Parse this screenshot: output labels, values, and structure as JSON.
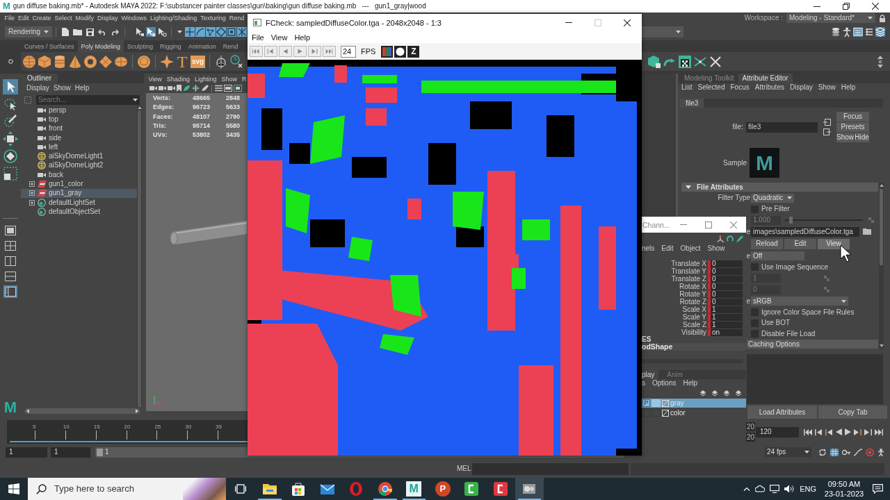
{
  "title_bar": {
    "logo": "M",
    "title": "gun diffuse baking.mb* - Autodesk MAYA 2022: F:\\substancer painter classes\\gun\\baking\\gun diffuse baking.mb   ---   gun1_gray|wood"
  },
  "menu_bar": [
    "File",
    "Edit",
    "Create",
    "Select",
    "Modify",
    "Display",
    "Windows",
    "Lighting/Shading",
    "Texturing",
    "Rend"
  ],
  "workspace": {
    "label": "Workspace :",
    "value": "Modeling - Standard*"
  },
  "status_line": {
    "menu_set": "Rendering",
    "select_modes": [
      {
        "kind": "hierarchy",
        "on": false
      },
      {
        "kind": "object",
        "on": true
      },
      {
        "kind": "component",
        "on": false
      }
    ],
    "masks": [
      {
        "kind": "cross",
        "on": true
      },
      {
        "kind": "curve",
        "on": true
      },
      {
        "kind": "points",
        "on": true
      },
      {
        "kind": "diamond",
        "on": true
      },
      {
        "kind": "frame",
        "on": true
      },
      {
        "kind": "burst",
        "on": true
      }
    ],
    "panel_toggles": [
      {
        "kind": "stack",
        "on": false
      },
      {
        "kind": "figure",
        "on": false
      },
      {
        "kind": "panel",
        "on": true
      },
      {
        "kind": "list",
        "on": false
      },
      {
        "kind": "layers",
        "on": true
      }
    ]
  },
  "shelf": {
    "tabs": [
      {
        "label": "Curves / Surfaces",
        "selected": false
      },
      {
        "label": "Poly Modeling",
        "selected": true
      },
      {
        "label": "Sculpting",
        "selected": false
      },
      {
        "label": "Rigging",
        "selected": false
      },
      {
        "label": "Animation",
        "selected": false
      },
      {
        "label": "Rend",
        "selected": false
      }
    ],
    "items": [
      {
        "kind": "sphere"
      },
      {
        "kind": "cube"
      },
      {
        "kind": "cylinder"
      },
      {
        "kind": "cone"
      },
      {
        "kind": "torus"
      },
      {
        "kind": "plane"
      },
      {
        "kind": "disc"
      },
      {
        "kind": "divider"
      },
      {
        "kind": "platonic"
      },
      {
        "kind": "divider"
      },
      {
        "kind": "star"
      },
      {
        "kind": "glyph",
        "text": "T"
      },
      {
        "kind": "badge",
        "text": "svg"
      },
      {
        "kind": "divider"
      },
      {
        "kind": "pivot"
      },
      {
        "kind": "clock"
      }
    ]
  },
  "toolbox": {
    "tools": [
      {
        "kind": "select",
        "selected": true
      },
      {
        "kind": "lasso",
        "selected": false
      },
      {
        "kind": "paint",
        "selected": false
      },
      {
        "kind": "move",
        "selected": false
      },
      {
        "kind": "rotate",
        "selected": false
      },
      {
        "kind": "scale",
        "selected": false
      }
    ],
    "layouts": [
      {
        "kind": "single",
        "selected": false
      },
      {
        "kind": "quad",
        "selected": false
      },
      {
        "kind": "side",
        "selected": false
      },
      {
        "kind": "stacked",
        "selected": false
      },
      {
        "kind": "outliner",
        "selected": true
      }
    ],
    "logo": "M"
  },
  "outliner": {
    "tab": "Outliner",
    "menu": [
      "Display",
      "Show",
      "Help"
    ],
    "search_placeholder": "Search...",
    "items": [
      {
        "label": "persp",
        "kind": "camera",
        "expander": false,
        "selected": false
      },
      {
        "label": "top",
        "kind": "camera",
        "expander": false,
        "selected": false
      },
      {
        "label": "front",
        "kind": "camera",
        "expander": false,
        "selected": false
      },
      {
        "label": "side",
        "kind": "camera",
        "expander": false,
        "selected": false
      },
      {
        "label": "left",
        "kind": "camera",
        "expander": false,
        "selected": false
      },
      {
        "label": "aiSkyDomeLight1",
        "kind": "light",
        "expander": false,
        "selected": false
      },
      {
        "label": "aiSkyDomeLight2",
        "kind": "light",
        "expander": false,
        "selected": false
      },
      {
        "label": "back",
        "kind": "camera",
        "expander": false,
        "selected": false
      },
      {
        "label": "gun1_color",
        "kind": "layer",
        "expander": true,
        "selected": false
      },
      {
        "label": "gun1_gray",
        "kind": "layer",
        "expander": true,
        "selected": true
      },
      {
        "label": "defaultLightSet",
        "kind": "set",
        "expander": true,
        "selected": false
      },
      {
        "label": "defaultObjectSet",
        "kind": "set",
        "expander": false,
        "selected": false
      }
    ]
  },
  "viewport": {
    "menu": [
      "View",
      "Shading",
      "Lighting",
      "Show",
      "R"
    ],
    "hud": [
      {
        "label": "Verts:",
        "total": "48665",
        "selection": "2848"
      },
      {
        "label": "Edges:",
        "total": "96723",
        "selection": "5633"
      },
      {
        "label": "Faces:",
        "total": "48107",
        "selection": "2790"
      },
      {
        "label": "Tris:",
        "total": "95714",
        "selection": "5580"
      },
      {
        "label": "UVs:",
        "total": "53802",
        "selection": "3435"
      }
    ]
  },
  "attribute_editor": {
    "tabs": [
      {
        "label": "Modeling Toolkit",
        "selected": false
      },
      {
        "label": "Attribute Editor",
        "selected": true
      }
    ],
    "menu": [
      "List",
      "Selected",
      "Focus",
      "Attributes",
      "Display",
      "Show",
      "Help"
    ],
    "node_tab": "file3",
    "node_label": "file:",
    "node_name": "file3",
    "side_buttons": [
      "Focus",
      "Presets",
      "Show",
      "Hide"
    ],
    "sample_label": "Sample",
    "sample_swatch": "M",
    "section": {
      "title": "File Attributes",
      "expanded": true,
      "rows": [
        {
          "kind": "dropdown",
          "label": "Filter Type",
          "value": "Quadratic"
        },
        {
          "kind": "checkbox",
          "label": "Pre Filter",
          "checked": false
        },
        {
          "kind": "slider",
          "value": "1.000",
          "disabled": true,
          "level": 0.07
        },
        {
          "kind": "file",
          "label": "e",
          "value": "images\\sampledDiffuseColor.tga"
        },
        {
          "kind": "buttons",
          "buttons": [
            {
              "label": "Reload",
              "hovered": false
            },
            {
              "label": "Edit",
              "hovered": false
            },
            {
              "label": "View",
              "hovered": true
            }
          ]
        },
        {
          "kind": "field",
          "label": "e",
          "value": "Off"
        },
        {
          "kind": "checkbox",
          "label": "Use Image Sequence",
          "checked": false
        },
        {
          "kind": "number",
          "value": "1",
          "disabled": true
        },
        {
          "kind": "number",
          "value": "0",
          "disabled": true
        },
        {
          "kind": "dropdown",
          "label": "e",
          "value": "sRGB"
        },
        {
          "kind": "checkbox",
          "label": "Ignore Color Space File Rules",
          "checked": false
        },
        {
          "kind": "checkbox",
          "label": "Use BOT",
          "checked": false
        },
        {
          "kind": "checkbox",
          "label": "Disable File Load",
          "checked": false
        }
      ]
    },
    "next_section": "Caching Options",
    "bottom_buttons": [
      "Load Attributes",
      "Copy Tab"
    ]
  },
  "channel_box": {
    "title": "Chann...",
    "menu": [
      "nels",
      "Edit",
      "Object",
      "Show"
    ],
    "channels": [
      {
        "label": "Translate X",
        "value": "0",
        "keyed": true
      },
      {
        "label": "Translate Y",
        "value": "0",
        "keyed": true
      },
      {
        "label": "Translate Z",
        "value": "0",
        "keyed": true
      },
      {
        "label": "Rotate X",
        "value": "0",
        "keyed": true
      },
      {
        "label": "Rotate Y",
        "value": "0",
        "keyed": true
      },
      {
        "label": "Rotate Z",
        "value": "0",
        "keyed": true
      },
      {
        "label": "Scale X",
        "value": "1",
        "keyed": true
      },
      {
        "label": "Scale Y",
        "value": "1",
        "keyed": true
      },
      {
        "label": "Scale Z",
        "value": "1",
        "keyed": true
      },
      {
        "label": "Visibility",
        "value": "on",
        "keyed": true
      }
    ],
    "shapes_heading": "ES",
    "shape_name": "odShape",
    "layer_editor": {
      "tabs": [
        {
          "label": "play",
          "selected": true
        },
        {
          "label": "Anim",
          "selected": false
        }
      ],
      "menu": [
        "s",
        "Options",
        "Help"
      ],
      "layers": [
        {
          "name": "gray",
          "selected": true,
          "p_button": "P"
        },
        {
          "name": "color",
          "selected": false
        }
      ]
    }
  },
  "fcheck": {
    "title": "FCheck: sampledDiffuseColor.tga - 2048x2048 - 1:3",
    "menu": [
      "File",
      "View",
      "Help"
    ],
    "fps": "24",
    "fps_label": "FPS",
    "depth_button": "Z"
  },
  "time_slider": {
    "ticks": [
      "5",
      "10",
      "15",
      "20",
      "25",
      "30",
      "35"
    ],
    "end_partial": [
      "20",
      "20"
    ],
    "end_time": "120"
  },
  "range_slider": {
    "start": "1",
    "playback_start": "1",
    "current": "1",
    "fps": "24 fps"
  },
  "command_line": {
    "language": "MEL"
  },
  "taskbar": {
    "search_placeholder": "Type here to search",
    "apps": [
      {
        "kind": "explorer",
        "running": true,
        "active": false
      },
      {
        "kind": "store",
        "running": false,
        "active": false
      },
      {
        "kind": "mail",
        "running": false,
        "active": false
      },
      {
        "kind": "opera",
        "running": false,
        "active": false
      },
      {
        "kind": "chrome",
        "running": true,
        "active": false
      },
      {
        "kind": "maya",
        "glyph": "M",
        "running": true,
        "active": false
      },
      {
        "kind": "powerpoint",
        "glyph": "P",
        "running": false,
        "active": false
      },
      {
        "kind": "green",
        "running": false,
        "active": false
      },
      {
        "kind": "red",
        "running": false,
        "active": false
      },
      {
        "kind": "viewer",
        "running": true,
        "active": true
      }
    ],
    "language": "ENG",
    "time": "09:50 AM",
    "date": "23-01-2023"
  }
}
